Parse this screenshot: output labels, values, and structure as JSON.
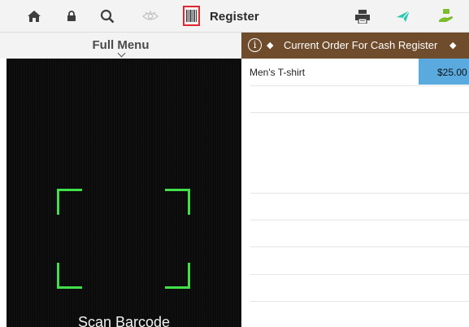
{
  "toolbar": {
    "icons": [
      "home-icon",
      "lock-icon",
      "search-icon",
      "eye-icon",
      "barcode-icon",
      "printer-icon",
      "send-icon",
      "cash-icon"
    ],
    "title": "Register",
    "colors": {
      "active_border": "#e0282e",
      "send_icon": "#2fc6b0",
      "cash_icon": "#7bbd2a"
    }
  },
  "menu": {
    "title": "Full Menu"
  },
  "scanner": {
    "label": "Scan Barcode",
    "frame_color": "#3fe04a"
  },
  "order": {
    "title": "Current Order For Cash Register",
    "header_color": "#6e4c2c",
    "items": [
      {
        "name": "Men's T-shirt",
        "price": "$25.00"
      }
    ],
    "price_color": "#5aaadf"
  }
}
